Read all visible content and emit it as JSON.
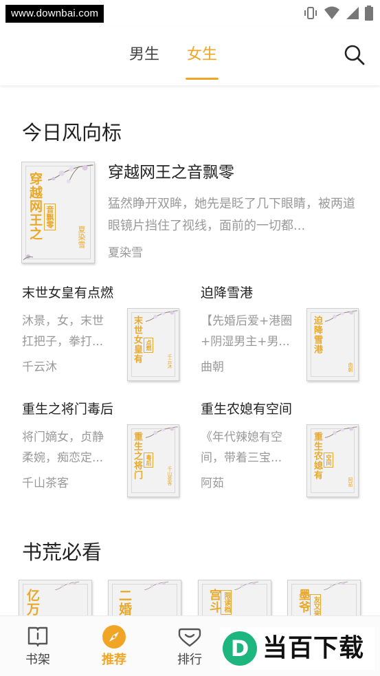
{
  "status_bar": {
    "url_watermark": "www.downbai.com",
    "icons": [
      "vibrate-icon",
      "wifi-icon",
      "signal-icon",
      "battery-icon"
    ]
  },
  "top_tabs": {
    "tabs": [
      {
        "label": "男生",
        "active": false
      },
      {
        "label": "女生",
        "active": true
      }
    ],
    "accent_color": "#f0a526",
    "search_icon": "search-icon"
  },
  "sections": {
    "today": {
      "title": "今日风向标",
      "featured": {
        "title": "穿越网王之音飘零",
        "description": "猛然睁开双眸，她先是眨了几下眼睛，被两道眼镜片挡住了视线，面前的一切都...",
        "author": "夏染雪",
        "cover": {
          "title": "穿越网王之",
          "subtitle": "音飘零",
          "author": "夏染雪"
        }
      },
      "grid": [
        {
          "title": "末世女皇有点燃",
          "description": "沐景，女，末世扛把子，拳打...",
          "author": "千云沐",
          "cover": {
            "title": "末世女皇有",
            "subtitle": "点燃",
            "author": "千云沐"
          }
        },
        {
          "title": "迫降雪港",
          "description": "【先婚后爱+港圈+阴湿男主+男...",
          "author": "曲朝",
          "cover": {
            "title": "迫降雪港",
            "subtitle": "",
            "author": "曲朝"
          }
        },
        {
          "title": "重生之将门毒后",
          "description": "将门嫡女，贞静柔婉，痴恋定...",
          "author": "千山茶客",
          "cover": {
            "title": "重生之将门",
            "subtitle": "毒后",
            "author": "千山茶客"
          }
        },
        {
          "title": "重生农媳有空间",
          "description": "《年代辣媳有空间，带着三宝...",
          "author": "阿茹",
          "cover": {
            "title": "重生农媳有",
            "subtitle": "空间",
            "author": "阿茹"
          }
        }
      ]
    },
    "must_read": {
      "title": "书荒必看",
      "covers": [
        {
          "title": "亿万",
          "subtitle": ""
        },
        {
          "title": "二婚",
          "subtitle": ""
        },
        {
          "title": "宫斗",
          "subtitle": "限读档"
        },
        {
          "title": "墨爷",
          "subtitle": "友又来"
        }
      ]
    }
  },
  "bottom_nav": {
    "items": [
      {
        "label": "书架",
        "icon": "bookshelf-icon",
        "active": false
      },
      {
        "label": "推荐",
        "icon": "compass-icon",
        "active": true
      },
      {
        "label": "排行",
        "icon": "ranking-icon",
        "active": false
      }
    ]
  },
  "brand_watermark": {
    "letter": "D",
    "text": "当百下载",
    "color": "#1db67e"
  }
}
